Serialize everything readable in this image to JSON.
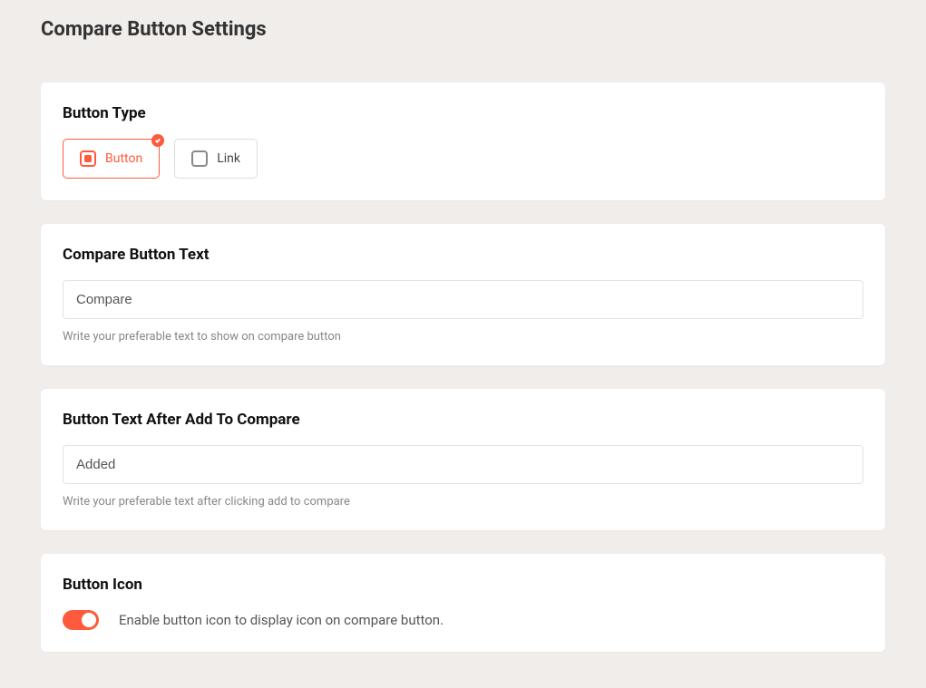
{
  "header": {
    "title": "Compare Button Settings"
  },
  "buttonType": {
    "title": "Button Type",
    "options": {
      "button": "Button",
      "link": "Link"
    }
  },
  "compareText": {
    "title": "Compare Button Text",
    "value": "Compare",
    "helper": "Write your preferable text to show on compare button"
  },
  "afterAddText": {
    "title": "Button Text After Add To Compare",
    "value": "Added",
    "helper": "Write your preferable text after clicking add to compare"
  },
  "buttonIcon": {
    "title": "Button Icon",
    "label": "Enable button icon to display icon on compare button.",
    "enabled": true
  }
}
